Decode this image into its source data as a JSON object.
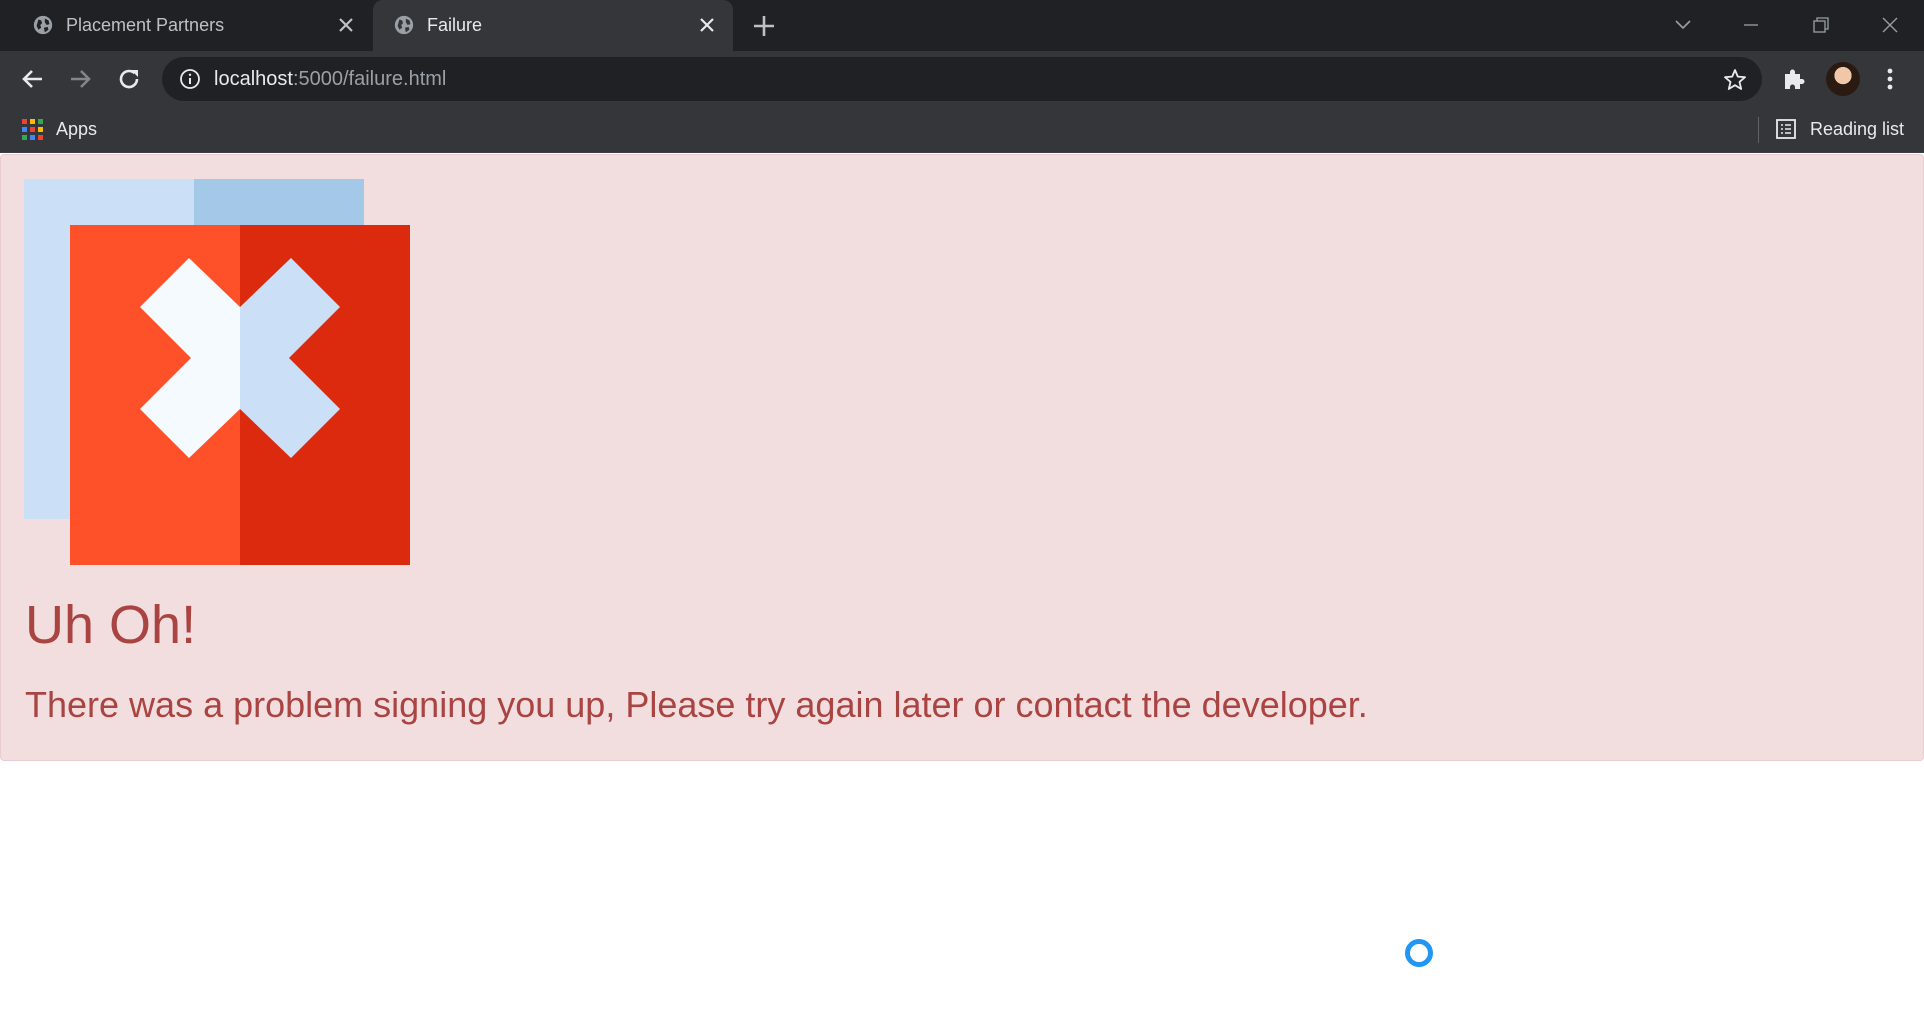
{
  "browser": {
    "tabs": [
      {
        "title": "Placement Partners",
        "active": false
      },
      {
        "title": "Failure",
        "active": true
      }
    ],
    "address": {
      "host": "localhost",
      "rest": ":5000/failure.html"
    },
    "bookmarks": {
      "apps_label": "Apps",
      "reading_list_label": "Reading list"
    }
  },
  "page": {
    "heading": "Uh Oh!",
    "message": "There was a problem signing you up, Please try again later or contact the developer.",
    "alert_bg": "#f2dede",
    "text_color": "#a94442",
    "image_icon": "failure-x-icon",
    "loading_icon": "loading-spinner-icon"
  }
}
